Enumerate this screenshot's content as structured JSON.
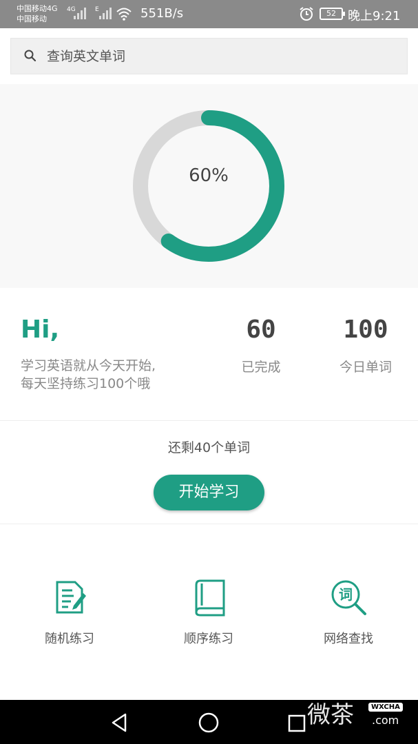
{
  "status_bar": {
    "carrier_line1": "中国移动4G",
    "carrier_line2": "中国移动",
    "net1": "4G",
    "net2": "E",
    "speed": "551B/s",
    "battery": "52",
    "time": "晚上9:21"
  },
  "search": {
    "placeholder": "查询英文单词"
  },
  "progress": {
    "label": "60%",
    "fraction": 0.6,
    "colors": {
      "done": "#1f9e84",
      "remaining": "#d8d8d8"
    }
  },
  "stats": {
    "greeting": "Hi,",
    "motto_line1": "学习英语就从今天开始,",
    "motto_line2": "每天坚持练习100个哦",
    "completed_value": "60",
    "completed_label": "已完成",
    "daily_value": "100",
    "daily_label": "今日单词"
  },
  "remaining": {
    "text": "还剩40个单词",
    "start_label": "开始学习"
  },
  "features": [
    {
      "label": "随机练习",
      "icon": "random-practice-icon"
    },
    {
      "label": "顺序练习",
      "icon": "book-icon"
    },
    {
      "label": "网络查找",
      "icon": "word-search-icon"
    }
  ],
  "watermark": {
    "main": "微茶",
    "badge": "WXCHA",
    "suffix": ".com"
  },
  "accent_color": "#1f9e84"
}
